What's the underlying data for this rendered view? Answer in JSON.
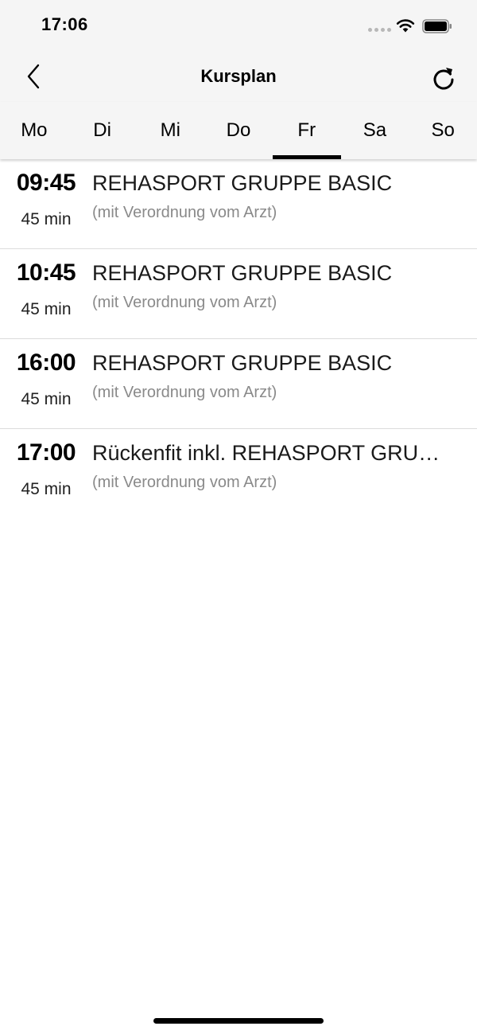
{
  "status_bar": {
    "time": "17:06",
    "icons": [
      "signal-dots-icon",
      "wifi-icon",
      "battery-icon"
    ]
  },
  "nav": {
    "title": "Kursplan",
    "back_icon": "chevron-left-icon",
    "refresh_icon": "refresh-icon"
  },
  "days": {
    "selected": "Fr",
    "items": [
      {
        "label": "Mo"
      },
      {
        "label": "Di"
      },
      {
        "label": "Mi"
      },
      {
        "label": "Do"
      },
      {
        "label": "Fr"
      },
      {
        "label": "Sa"
      },
      {
        "label": "So"
      }
    ]
  },
  "courses": [
    {
      "time": "09:45",
      "duration": "45 min",
      "title": "REHASPORT GRUPPE BASIC",
      "subtitle": "(mit Verordnung vom Arzt)"
    },
    {
      "time": "10:45",
      "duration": "45 min",
      "title": "REHASPORT GRUPPE BASIC",
      "subtitle": "(mit Verordnung vom Arzt)"
    },
    {
      "time": "16:00",
      "duration": "45 min",
      "title": "REHASPORT GRUPPE BASIC",
      "subtitle": "(mit Verordnung vom Arzt)"
    },
    {
      "time": "17:00",
      "duration": "45 min",
      "title": "Rückenfit inkl. REHASPORT GRUPPE BASIC",
      "subtitle": "(mit Verordnung vom Arzt)"
    }
  ],
  "colors": {
    "header_background": "#f5f5f5",
    "selected_tab_indicator": "#000000",
    "subtitle_text": "#8a8a8a",
    "divider": "#dcdcdc"
  }
}
